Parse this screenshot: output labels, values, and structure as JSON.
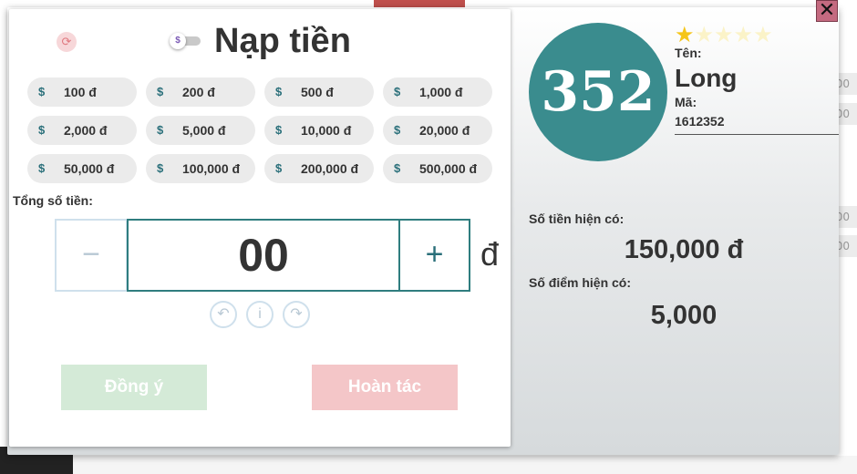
{
  "background": {
    "rows": [
      "00",
      "00",
      "00",
      "00"
    ]
  },
  "dialog": {
    "title": "Nạp tiền",
    "close_label": "✕",
    "amounts": [
      "100 đ",
      "200 đ",
      "500 đ",
      "1,000 đ",
      "2,000 đ",
      "5,000 đ",
      "10,000 đ",
      "20,000 đ",
      "50,000 đ",
      "100,000 đ",
      "200,000 đ",
      "500,000 đ"
    ],
    "amount_icon": "$",
    "total_label": "Tổng số tiền:",
    "minus_label": "−",
    "plus_label": "+",
    "amount_value": "00",
    "currency": "đ",
    "undo_icon": "↶",
    "info_icon": "i",
    "redo_icon": "↷",
    "confirm_label": "Đồng ý",
    "cancel_label": "Hoàn tác"
  },
  "profile": {
    "number": "352",
    "rating": 1,
    "rating_max": 5,
    "name_label": "Tên:",
    "name": "Long",
    "code_label": "Mã:",
    "code": "1612352",
    "balance_label": "Số tiền hiện có:",
    "balance": "150,000 đ",
    "points_label": "Số điểm hiện có:",
    "points": "5,000"
  },
  "colors": {
    "accent": "#3a8c8e",
    "confirm": "#d4ead7",
    "cancel": "#f4c6c8",
    "close": "#c46a80",
    "star_filled": "#f5c518"
  }
}
